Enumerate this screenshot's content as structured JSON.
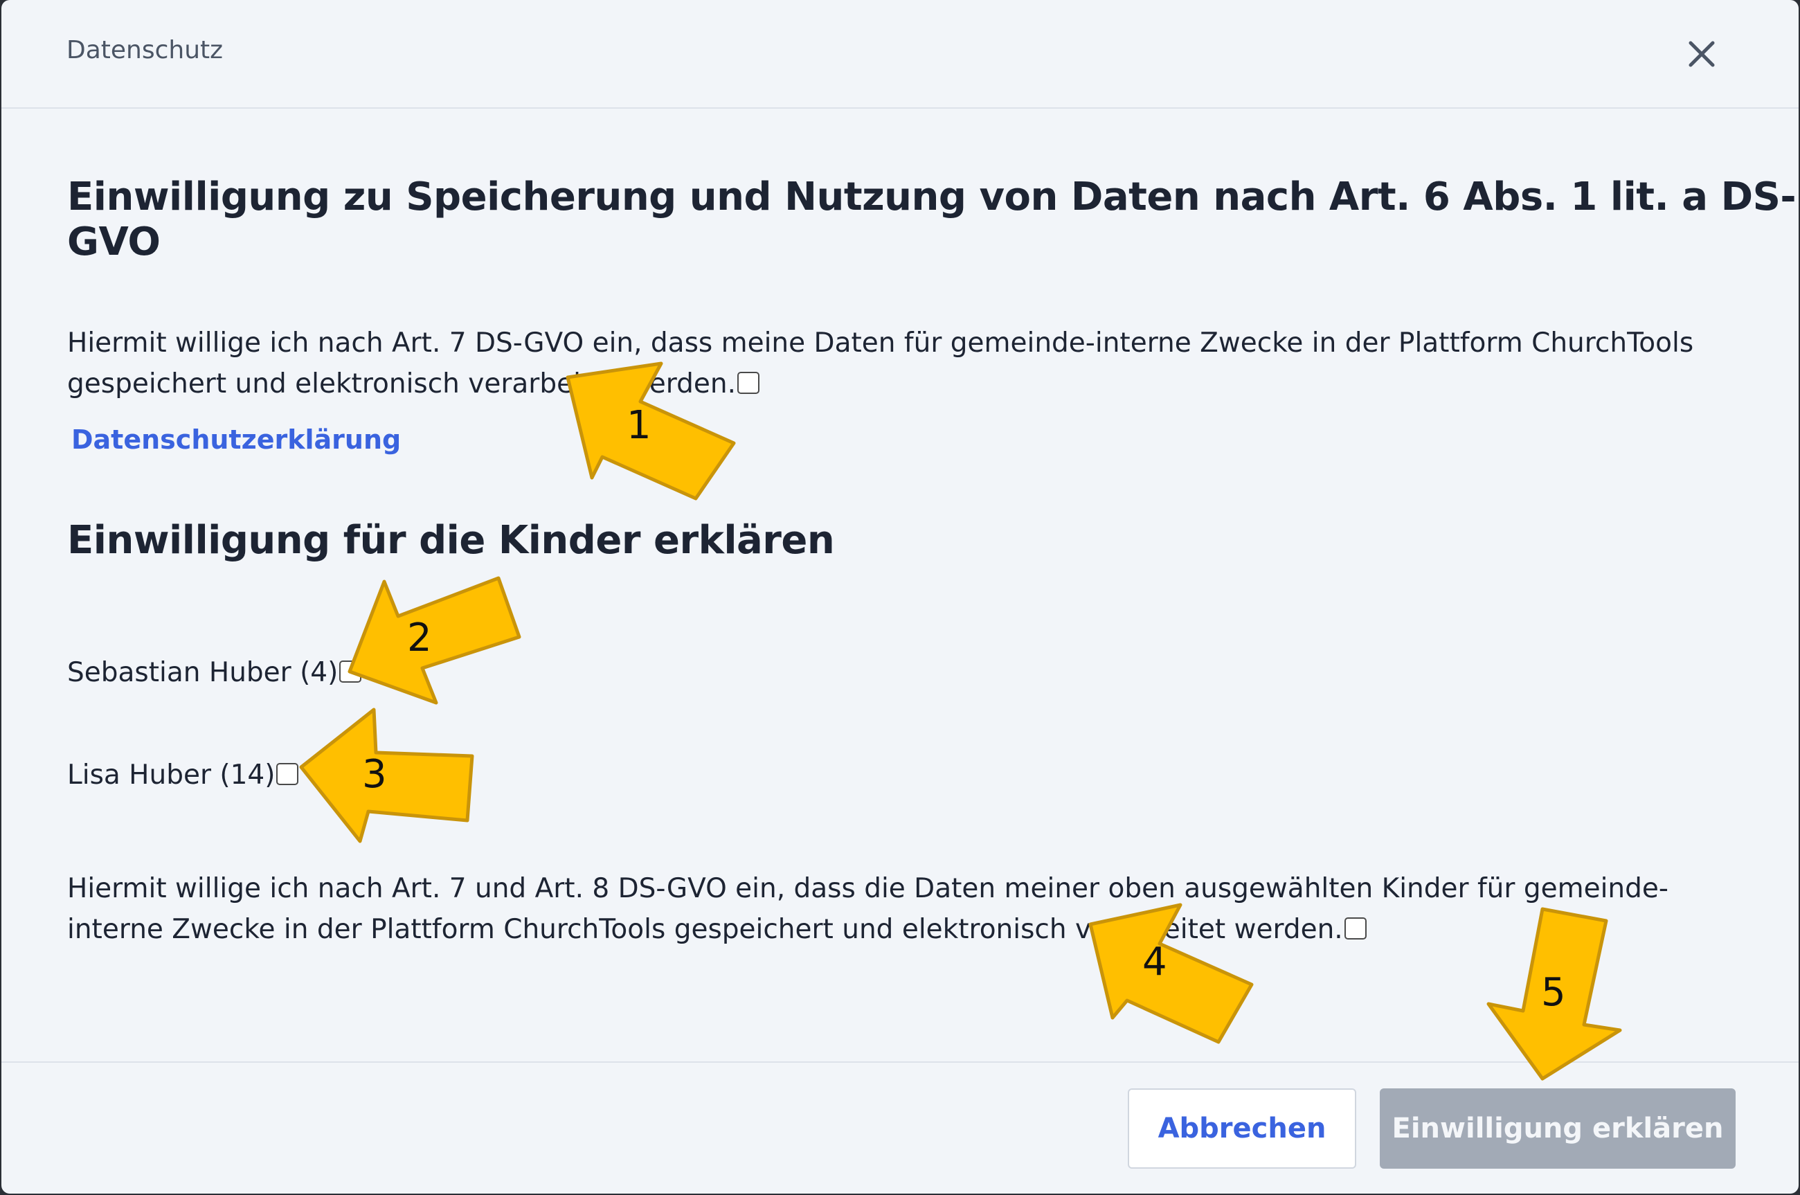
{
  "dialog": {
    "title": "Datenschutz",
    "close_icon": "close-icon"
  },
  "consent": {
    "heading": "Einwilligung zu Speicherung und Nutzung von Daten nach Art. 6 Abs. 1 lit. a DS-GVO",
    "text": "Hiermit willige ich nach Art. 7 DS-GVO ein, dass meine Daten für gemeinde-interne Zwecke in der Plattform ChurchTools gespeichert und elektronisch verarbeitet werden.",
    "checked": false,
    "privacy_link": "Datenschutzerklärung"
  },
  "children": {
    "heading": "Einwilligung für die Kinder erklären",
    "items": [
      {
        "label": "Sebastian Huber (4)",
        "checked": false
      },
      {
        "label": "Lisa Huber (14)",
        "checked": false
      }
    ],
    "consent_text": "Hiermit willige ich nach Art. 7 und Art. 8 DS-GVO ein, dass die Daten meiner oben ausgewählten Kinder für gemeinde-interne Zwecke in der Plattform ChurchTools gespeichert und elektronisch verarbeitet werden.",
    "consent_checked": false
  },
  "footer": {
    "cancel_label": "Abbrechen",
    "confirm_label": "Einwilligung erklären"
  },
  "annotations": {
    "arrow_color": "#ffbf00",
    "arrow_outline": "#c9940a",
    "numbers": [
      "1",
      "2",
      "3",
      "4",
      "5"
    ]
  }
}
